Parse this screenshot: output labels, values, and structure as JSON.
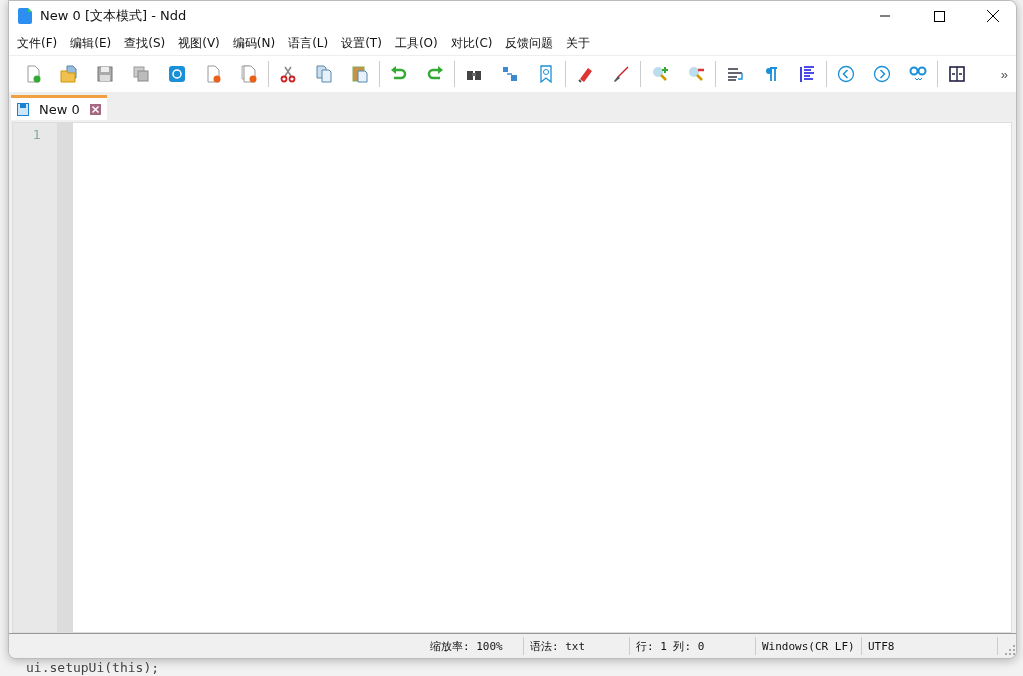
{
  "window": {
    "title": "New 0 [文本模式] - Ndd"
  },
  "menu": [
    "文件(F)",
    "编辑(E)",
    "查找(S)",
    "视图(V)",
    "编码(N)",
    "语言(L)",
    "设置(T)",
    "工具(O)",
    "对比(C)",
    "反馈问题",
    "关于"
  ],
  "toolbar": {
    "overflow": "»"
  },
  "tabs": [
    {
      "label": "New 0",
      "selected": true
    }
  ],
  "editor": {
    "line_numbers": [
      "1"
    ]
  },
  "status_bar": [
    "缩放率: 100%",
    "语法: txt",
    "行: 1 列: 0",
    "Windows(CR LF)",
    "UTF8"
  ],
  "background": {
    "code_line": "ui.setupUi(this);"
  }
}
